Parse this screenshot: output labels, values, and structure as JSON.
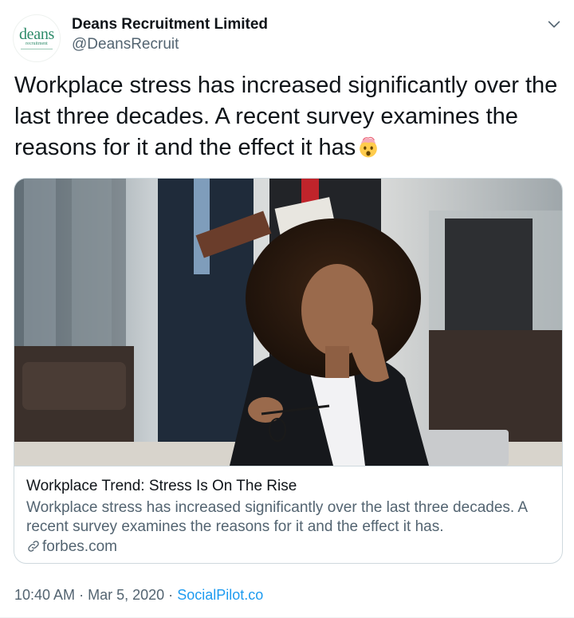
{
  "tweet": {
    "author": {
      "name": "Deans Recruitment Limited",
      "handle": "@DeansRecruit",
      "avatar_wordmark": "deans",
      "avatar_subtext": "recruitment"
    },
    "text": "Workplace stress has increased significantly over the last three decades. A recent survey examines the reasons for it and the effect it has",
    "emoji_icon": "exploding-head-icon",
    "card": {
      "title": "Workplace Trend: Stress Is On The Rise",
      "description": "Workplace stress has increased significantly over the last three decades. A recent survey examines the reasons for it and the effect it has.",
      "domain": "forbes.com",
      "image_icon": "stressed-woman-office-photo"
    },
    "meta": {
      "time": "10:40 AM",
      "separator": "·",
      "date": "Mar 5, 2020",
      "source": "SocialPilot.co"
    }
  },
  "colors": {
    "text_primary": "#0f1419",
    "text_secondary": "#536471",
    "link": "#1d9bf0",
    "border": "#cfd9de",
    "brand_green": "#2e8b6a"
  }
}
